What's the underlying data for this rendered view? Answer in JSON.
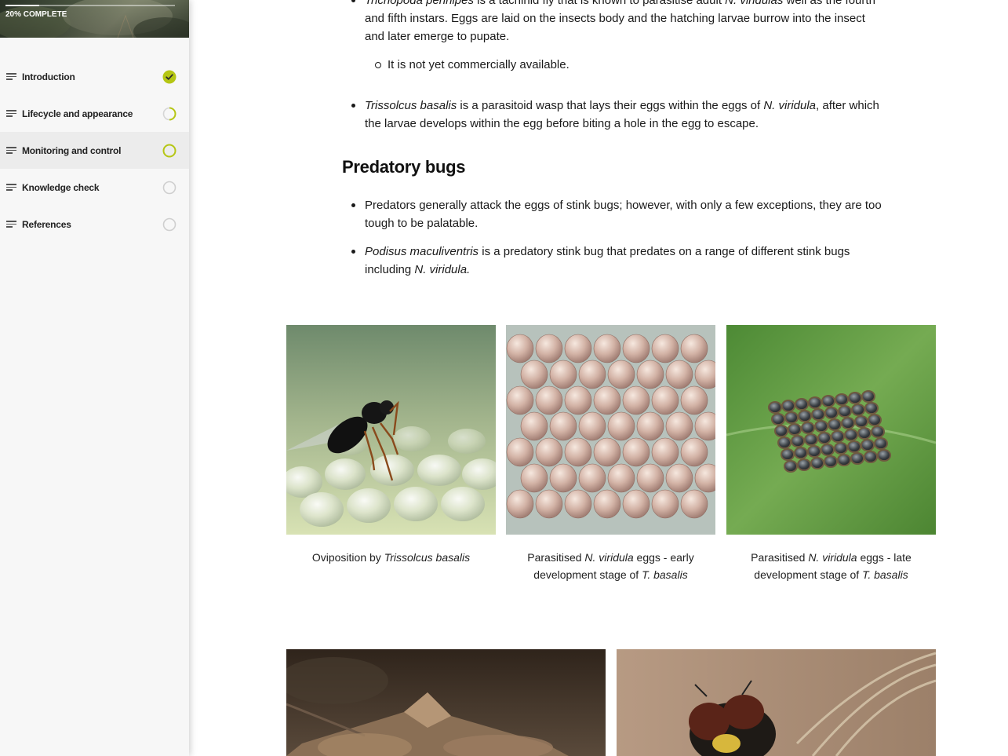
{
  "sidebar": {
    "progress_label": "20% COMPLETE",
    "progress_fraction": 0.2,
    "items": [
      {
        "label": "Introduction",
        "status": "complete"
      },
      {
        "label": "Lifecycle and appearance",
        "status": "partial"
      },
      {
        "label": "Monitoring and control",
        "status": "partial"
      },
      {
        "label": "Knowledge check",
        "status": "empty"
      },
      {
        "label": "References",
        "status": "empty"
      }
    ]
  },
  "colors": {
    "accent": "#b5c614",
    "check_mark": "#333333",
    "empty_circle": "#cfcfcf"
  },
  "main": {
    "partial_top": {
      "species": "Trichopoda pennipes",
      "text_1": " is a tachinid fly that is known to parasitise adult ",
      "target": "N. viridulas",
      "text_2": " well as the fourth",
      "line_2": "and fifth instars. Eggs are laid on the insects body and the hatching larvae burrow into the insect",
      "line_3": "and later emerge to pupate."
    },
    "sub_bullet": "It is not yet commercially available.",
    "trissolcus_bullet": {
      "species": "Trissolcus basalis",
      "text_1": " is a parasitoid wasp that lays their eggs within the eggs of ",
      "target": "N. viridula",
      "text_2": ", after which",
      "line_2": "the larvae develops within the egg before biting a hole in the egg to escape."
    },
    "heading": "Predatory bugs",
    "predators_bullet": {
      "line_1": "Predators generally attack the eggs of stink bugs; however, with only a few exceptions, they are too",
      "line_2": "tough to be palatable."
    },
    "podisus_bullet": {
      "species": "Podisus maculiventris",
      "text_1": " is a predatory stink bug that predates on a range of different stink bugs",
      "line_2_prefix": "including ",
      "target": "N. viridula.",
      "line_2_suffix": ""
    },
    "captions": [
      {
        "prefix": "Oviposition by ",
        "italic": "Trissolcus basalis",
        "suffix": ""
      },
      {
        "prefix": "Parasitised ",
        "italic": "N. viridula",
        "suffix": " eggs - early",
        "line2_prefix": "development stage of ",
        "line2_italic": "T. basalis"
      },
      {
        "prefix": "Parasitised ",
        "italic": "N. viridula",
        "suffix": " eggs - late",
        "line2_prefix": "development stage of ",
        "line2_italic": "T. basalis"
      }
    ]
  }
}
